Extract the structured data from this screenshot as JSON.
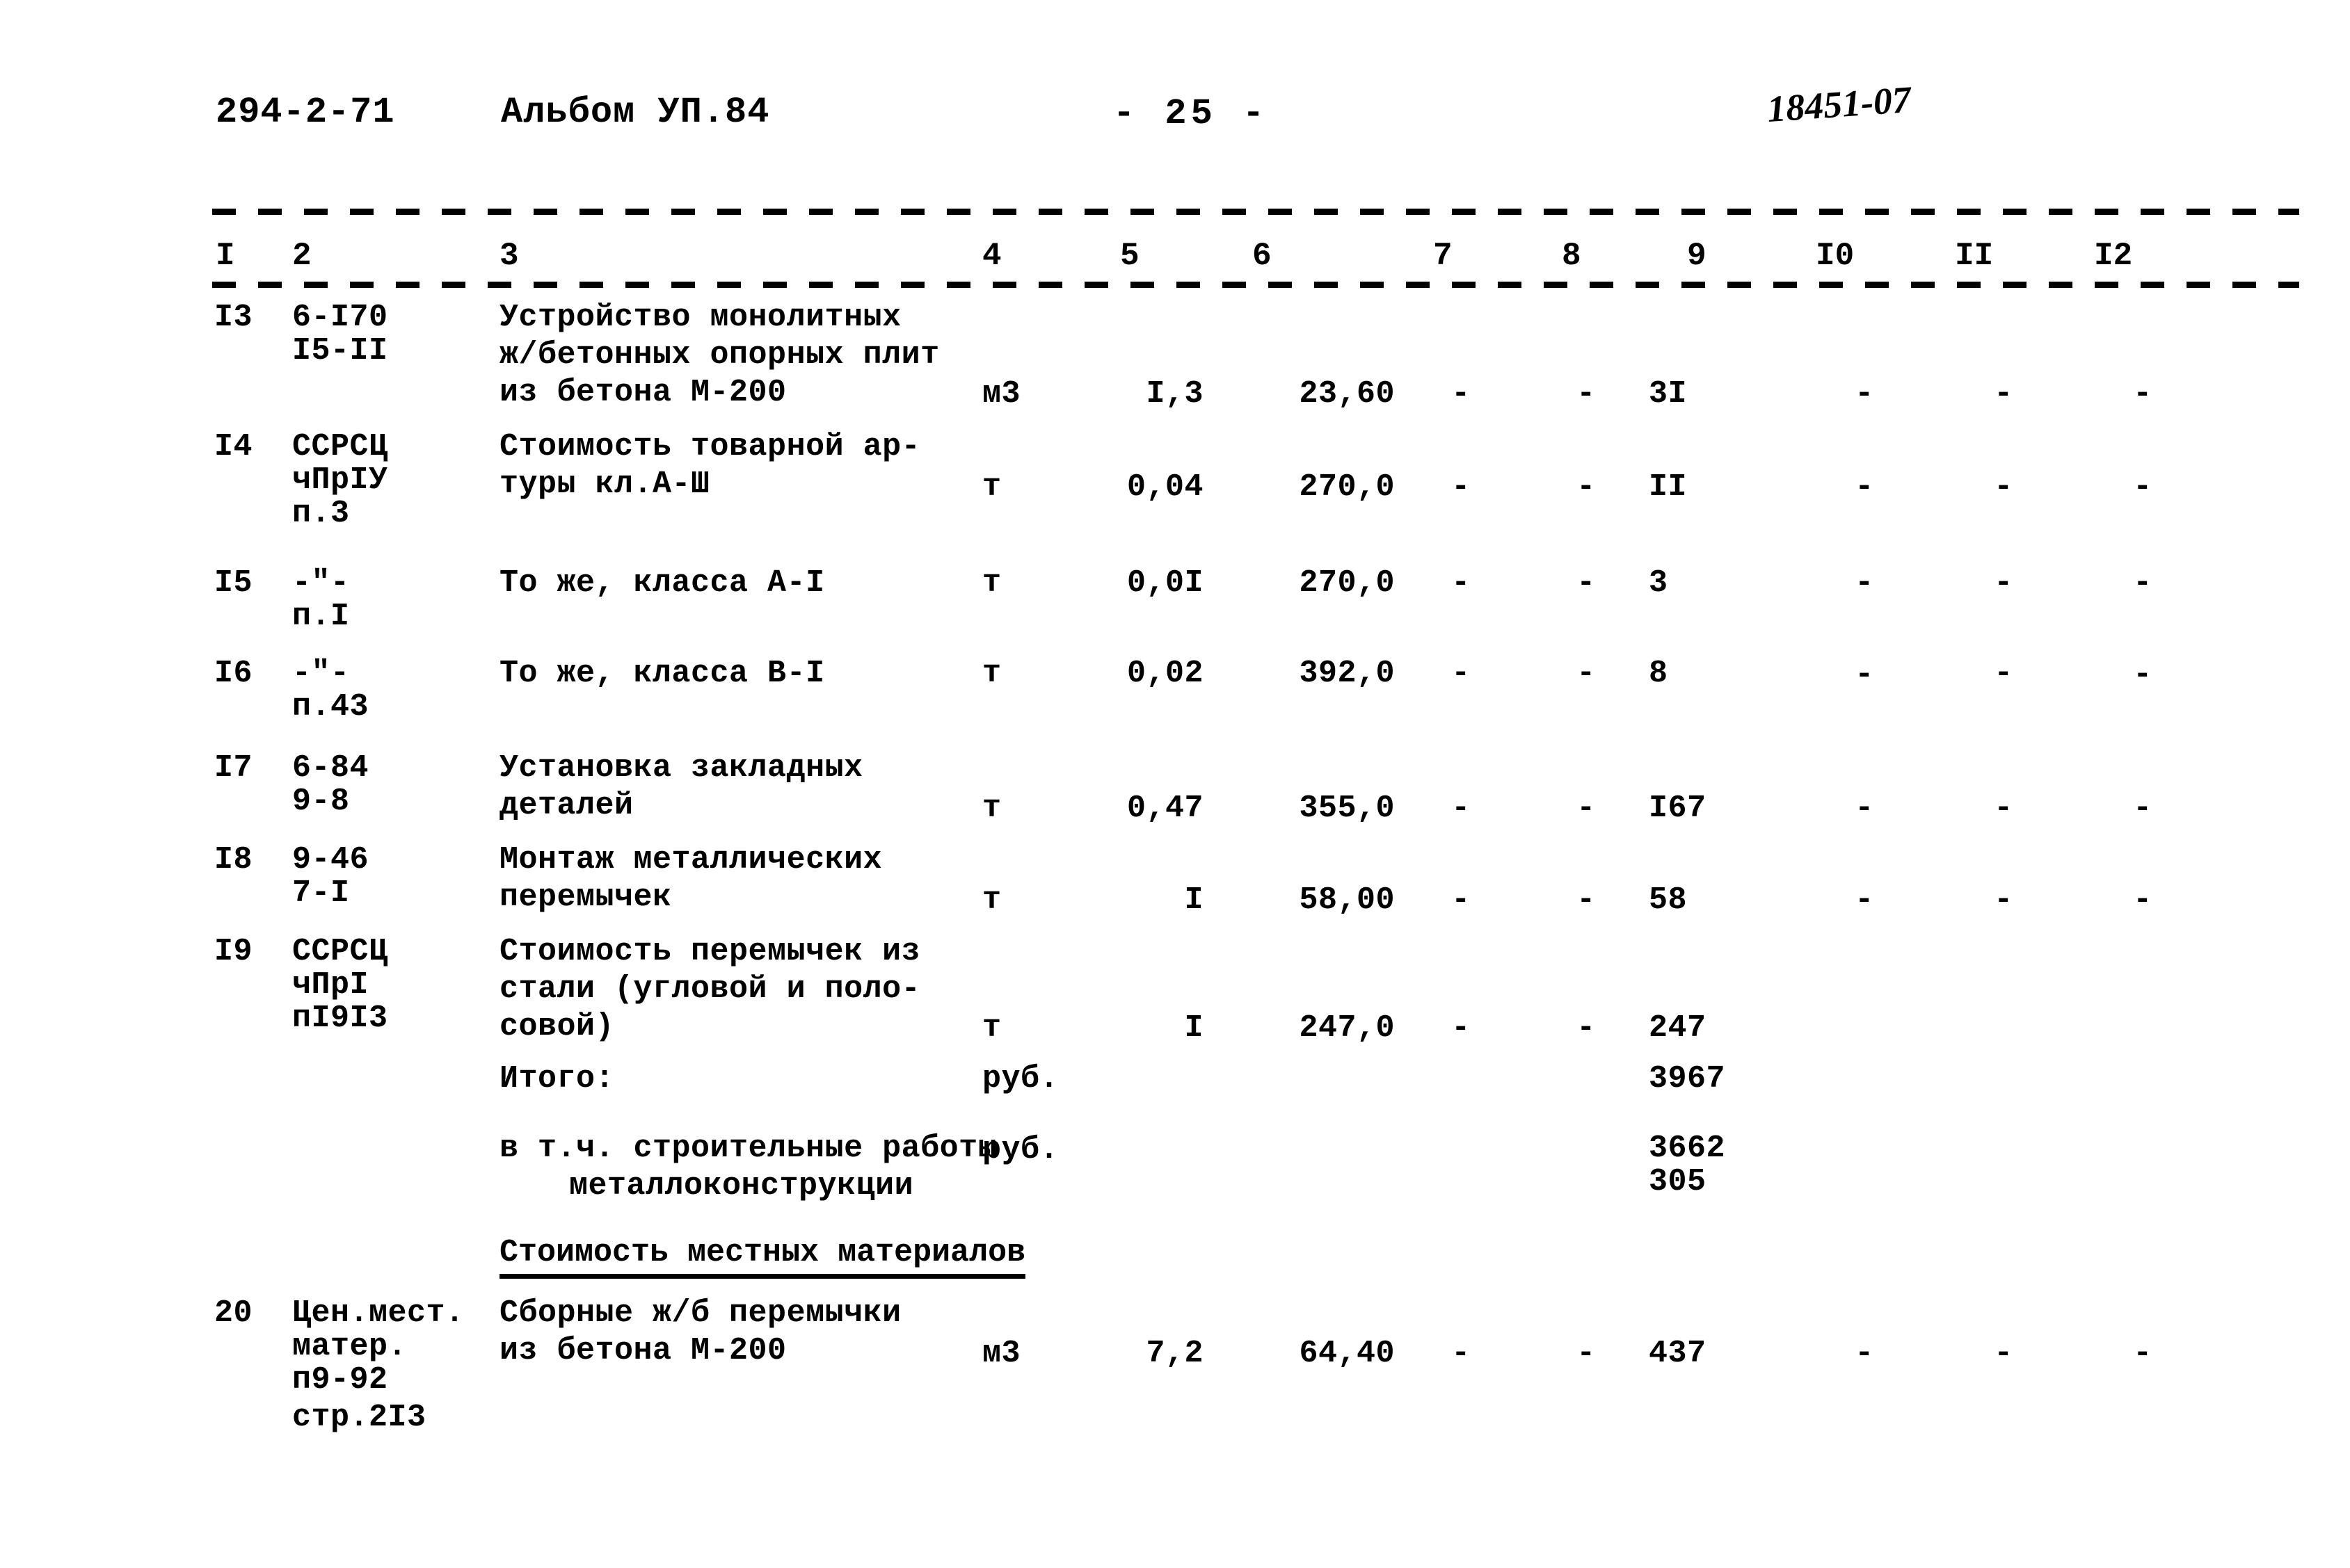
{
  "header": {
    "project_code": "294-2-71",
    "album": "Альбом УП.84",
    "page_label": "- 25 -",
    "archive_stamp": "18451-07"
  },
  "table": {
    "column_numbers": [
      "I",
      "2",
      "3",
      "4",
      "5",
      "6",
      "7",
      "8",
      "9",
      "I0",
      "II",
      "I2"
    ],
    "rows": [
      {
        "no": "I3",
        "code_lines": [
          "6-I70",
          "I5-II"
        ],
        "desc_lines": [
          "Устройство монолитных",
          "ж/бетонных опорных плит",
          "из бетона М-200"
        ],
        "unit": "м3",
        "qty": "I,3",
        "price": "23,60",
        "c7": "-",
        "c8": "-",
        "c9": "3I",
        "c10": "-",
        "c11": "-",
        "c12": "-"
      },
      {
        "no": "I4",
        "code_lines": [
          "ССРСЦ",
          "чПрIУ",
          "п.3"
        ],
        "desc_lines": [
          "Стоимость товарной ар-",
          "туры кл.А-Ш"
        ],
        "unit": "т",
        "qty": "0,04",
        "price": "270,0",
        "c7": "-",
        "c8": "-",
        "c9": "II",
        "c10": "-",
        "c11": "-",
        "c12": "-"
      },
      {
        "no": "I5",
        "code_lines": [
          "-\"-",
          "п.I"
        ],
        "desc_lines": [
          "То же, класса А-I"
        ],
        "unit": "т",
        "qty": "0,0I",
        "price": "270,0",
        "c7": "-",
        "c8": "-",
        "c9": "3",
        "c10": "-",
        "c11": "-",
        "c12": "-"
      },
      {
        "no": "I6",
        "code_lines": [
          "-\"-",
          "п.43"
        ],
        "desc_lines": [
          "То же, класса В-I"
        ],
        "unit": "т",
        "qty": "0,02",
        "price": "392,0",
        "c7": "-",
        "c8": "-",
        "c9": "8",
        "c10": "-",
        "c11": "-",
        "c12": "-"
      },
      {
        "no": "I7",
        "code_lines": [
          "6-84",
          "9-8"
        ],
        "desc_lines": [
          "Установка закладных",
          "деталей"
        ],
        "unit": "т",
        "qty": "0,47",
        "price": "355,0",
        "c7": "-",
        "c8": "-",
        "c9": "I67",
        "c10": "-",
        "c11": "-",
        "c12": "-"
      },
      {
        "no": "I8",
        "code_lines": [
          "9-46",
          "7-I"
        ],
        "desc_lines": [
          "Монтаж металлических",
          "перемычек"
        ],
        "unit": "т",
        "qty": "I",
        "price": "58,00",
        "c7": "-",
        "c8": "-",
        "c9": "58",
        "c10": "-",
        "c11": "-",
        "c12": "-"
      },
      {
        "no": "I9",
        "code_lines": [
          "ССРСЦ",
          "чПрI",
          "пI9I3"
        ],
        "desc_lines": [
          "Стоимость перемычек из",
          "стали (угловой и поло-",
          "совой)"
        ],
        "unit": "т",
        "qty": "I",
        "price": "247,0",
        "c7": "-",
        "c8": "-",
        "c9": "247",
        "c10": "-",
        "c11": "-",
        "c12": "-"
      },
      {
        "no": "20",
        "code_lines": [
          "Цен.мест.",
          "матер.",
          "п9-92",
          "стр.2I3"
        ],
        "desc_lines": [
          "Сборные ж/б перемычки",
          "из бетона М-200"
        ],
        "unit": "м3",
        "qty": "7,2",
        "price": "64,40",
        "c7": "-",
        "c8": "-",
        "c9": "437",
        "c10": "-",
        "c11": "-",
        "c12": "-"
      }
    ],
    "totals": {
      "total_label": "Итого:",
      "total_unit": "руб.",
      "total_value": "3967",
      "breakdown_label": "в т.ч. строительные работы",
      "breakdown_sublabel": "металлоконструкции",
      "breakdown_unit": "руб.",
      "breakdown_value_1": "3662",
      "breakdown_value_2": "305"
    },
    "section_heading": "Стоимость местных материалов"
  }
}
